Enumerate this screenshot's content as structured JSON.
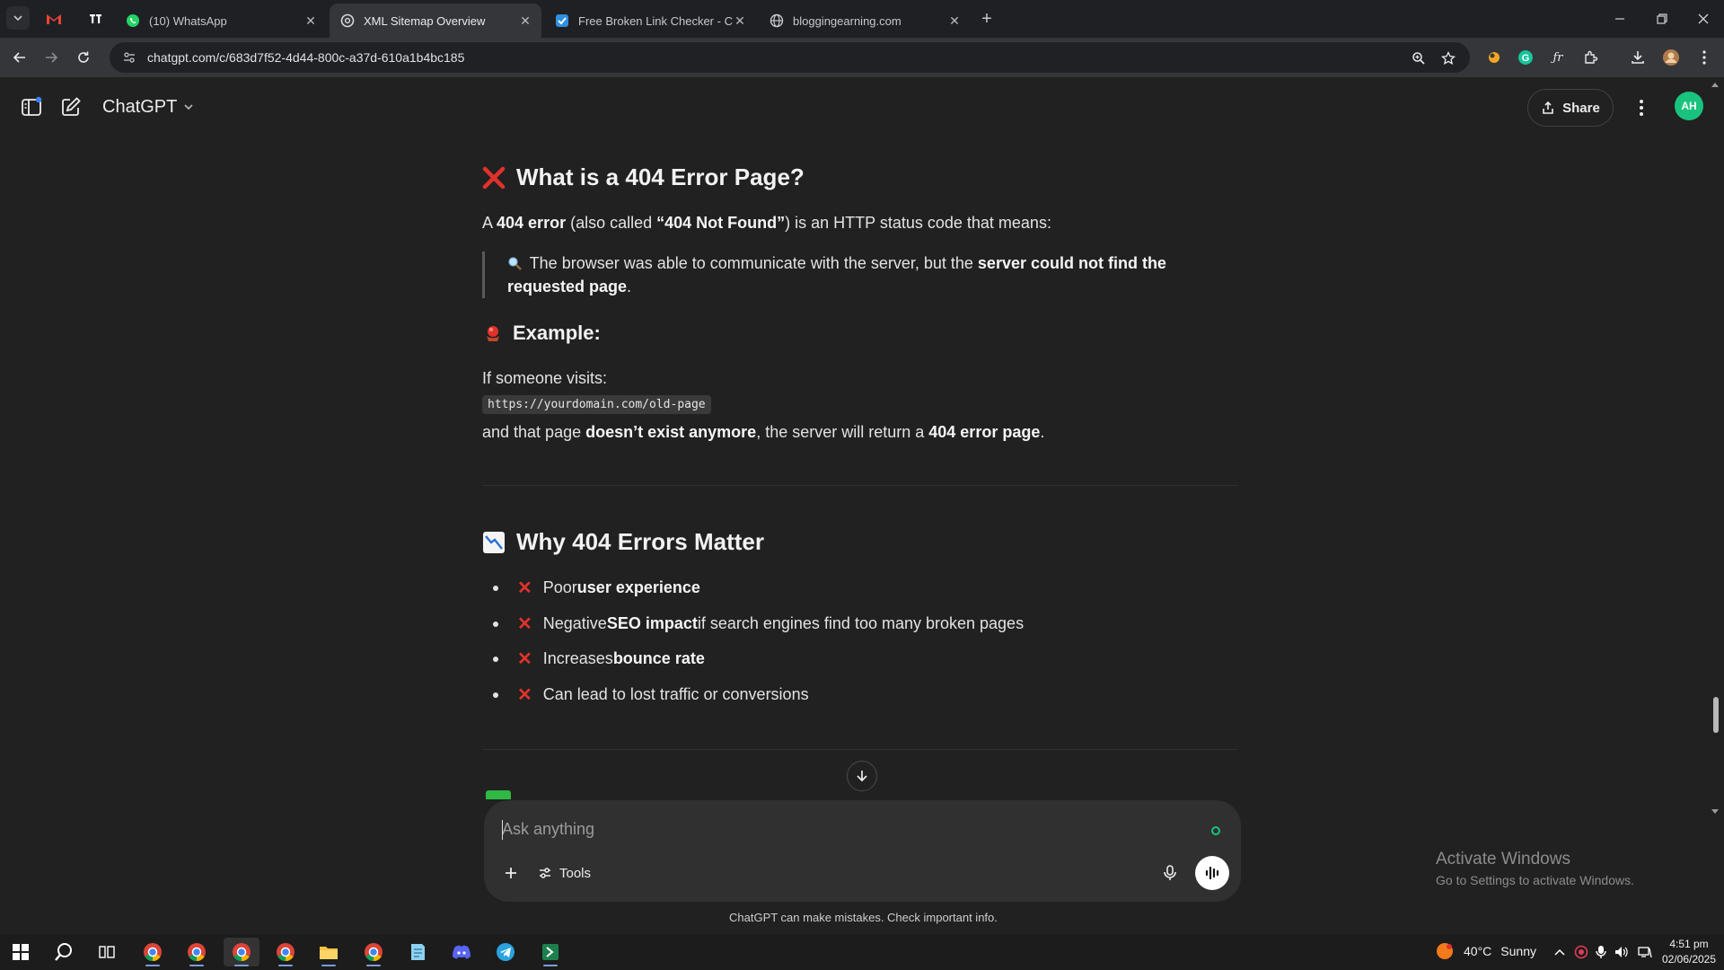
{
  "browser": {
    "tabs": [
      {
        "title": "(10) WhatsApp",
        "active": false
      },
      {
        "title": "XML Sitemap Overview",
        "active": true
      },
      {
        "title": "Free Broken Link Checker - Che",
        "active": false
      },
      {
        "title": "bloggingearning.com",
        "active": false
      }
    ],
    "url": "chatgpt.com/c/683d7f52-4d44-800c-a37d-610a1b4bc185"
  },
  "header": {
    "model_label": "ChatGPT",
    "share_label": "Share",
    "avatar_initials": "AH"
  },
  "content": {
    "section1": {
      "heading": "What is a 404 Error Page?",
      "intro": {
        "a": "A ",
        "b1": "404 error",
        "c": " (also called ",
        "b2": "“404 Not Found”",
        "d": ") is an HTTP status code that means:"
      },
      "quote": {
        "text": " The browser was able to communicate with the server, but the ",
        "bold": "server could not find the requested page",
        "end": "."
      }
    },
    "example": {
      "heading": "Example:",
      "lead": "If someone visits:",
      "code": "https://yourdomain.com/old-page",
      "after": {
        "a": "and that page ",
        "b1": "doesn’t exist anymore",
        "c": ", the server will return a ",
        "b2": "404 error page",
        "d": "."
      }
    },
    "section2": {
      "heading": "Why 404 Errors Matter",
      "items": [
        {
          "pre": "Poor ",
          "bold": "user experience",
          "post": ""
        },
        {
          "pre": "Negative ",
          "bold": "SEO impact",
          "post": " if search engines find too many broken pages"
        },
        {
          "pre": "Increases ",
          "bold": "bounce rate",
          "post": ""
        },
        {
          "pre": "Can lead to lost traffic or conversions",
          "bold": "",
          "post": ""
        }
      ]
    }
  },
  "composer": {
    "placeholder": "Ask anything",
    "tools_label": "Tools"
  },
  "disclaimer": "ChatGPT can make mistakes. Check important info.",
  "watermark": {
    "line1": "Activate Windows",
    "line2": "Go to Settings to activate Windows."
  },
  "taskbar": {
    "weather_temp": "40°C",
    "weather_cond": "Sunny",
    "time": "4:51 pm",
    "date": "02/06/2025"
  },
  "colors": {
    "accent_green": "#19c37d",
    "error_red": "#e0322b",
    "bg": "#212121"
  }
}
